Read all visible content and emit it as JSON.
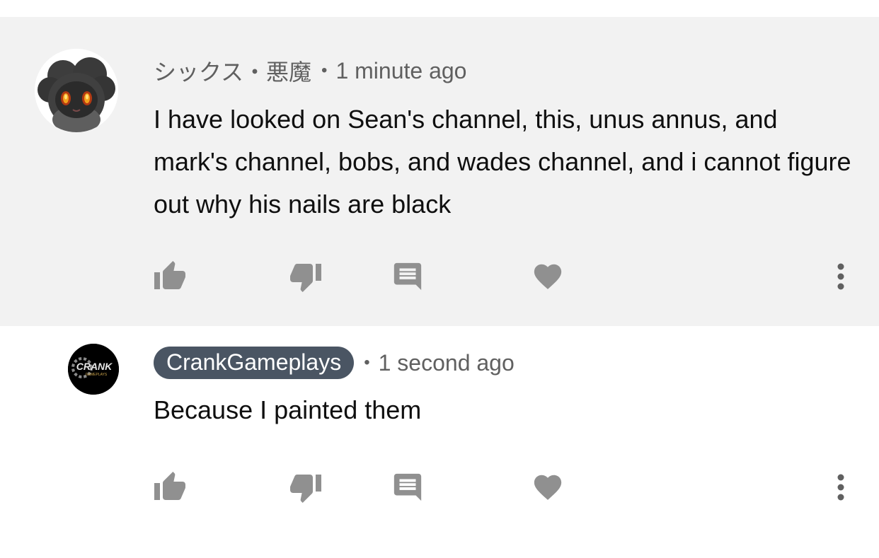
{
  "comments": [
    {
      "author": "シックス・悪魔",
      "separator": "•",
      "time": "1 minute ago",
      "text": "I have looked on Sean's channel, this, unus annus, and mark's channel, bobs, and wades channel, and i cannot figure out why his nails are black",
      "avatar_icon": "dark-creature-avatar"
    },
    {
      "author": "CrankGameplays",
      "separator": "•",
      "time": "1 second ago",
      "text": "Because I painted them",
      "avatar_icon": "crank-logo-avatar",
      "avatar_text": "CRANK",
      "avatar_subtext": "GAMEPLAYS"
    }
  ],
  "actions": {
    "like_icon": "thumbs-up-icon",
    "dislike_icon": "thumbs-down-icon",
    "reply_icon": "reply-icon",
    "heart_icon": "heart-icon",
    "more_icon": "more-vert-icon"
  },
  "colors": {
    "highlight_bg": "#f2f2f2",
    "icon_gray": "#909090",
    "author_chip_bg": "#4a5563",
    "meta_text": "#606060",
    "body_text": "#0f0f0f"
  }
}
